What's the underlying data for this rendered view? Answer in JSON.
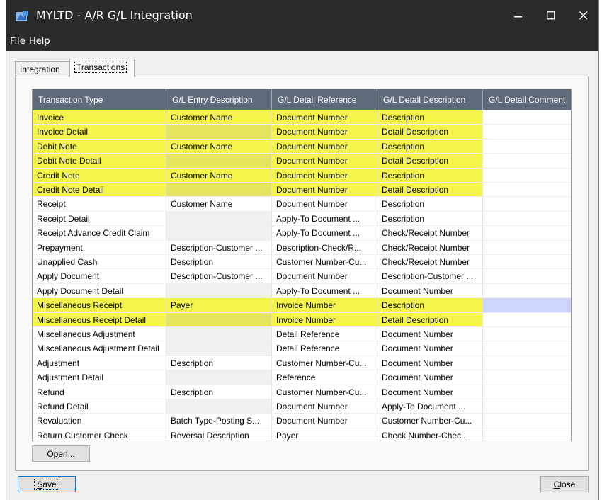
{
  "window": {
    "title": "MYLTD - A/R G/L Integration",
    "controls": {
      "minimize": "minimize",
      "maximize": "maximize",
      "close": "close"
    }
  },
  "menu": [
    {
      "accel": "F",
      "rest": "ile"
    },
    {
      "accel": "H",
      "rest": "elp"
    }
  ],
  "tabs": [
    {
      "label": "Integration",
      "active": false
    },
    {
      "label": "Transactions",
      "active": true
    }
  ],
  "grid": {
    "columns": [
      "Transaction Type",
      "G/L Entry Description",
      "G/L Detail Reference",
      "G/L Detail Description",
      "G/L Detail Comment"
    ],
    "rows": [
      {
        "cells": [
          "Invoice",
          "Customer Name",
          "Document Number",
          "Description",
          ""
        ],
        "highlight": true
      },
      {
        "cells": [
          "Invoice Detail",
          "",
          "Document Number",
          "Detail Description",
          ""
        ],
        "highlight": true
      },
      {
        "cells": [
          "Debit Note",
          "Customer Name",
          "Document Number",
          "Description",
          ""
        ],
        "highlight": true
      },
      {
        "cells": [
          "Debit Note Detail",
          "",
          "Document Number",
          "Detail Description",
          ""
        ],
        "highlight": true
      },
      {
        "cells": [
          "Credit Note",
          "Customer Name",
          "Document Number",
          "Description",
          ""
        ],
        "highlight": true
      },
      {
        "cells": [
          "Credit Note Detail",
          "",
          "Document Number",
          "Detail Description",
          ""
        ],
        "highlight": true
      },
      {
        "cells": [
          "Receipt",
          "Customer Name",
          "Document Number",
          "Description",
          ""
        ],
        "highlight": false
      },
      {
        "cells": [
          "Receipt Detail",
          "",
          "Apply-To Document ...",
          "Description",
          ""
        ],
        "highlight": false
      },
      {
        "cells": [
          "Receipt Advance Credit Claim",
          "",
          "Apply-To Document ...",
          "Check/Receipt Number",
          ""
        ],
        "highlight": false
      },
      {
        "cells": [
          "Prepayment",
          "Description-Customer ...",
          "Description-Check/R...",
          "Check/Receipt Number",
          ""
        ],
        "highlight": false
      },
      {
        "cells": [
          "Unapplied Cash",
          "Description",
          "Customer Number-Cu...",
          "Check/Receipt Number",
          ""
        ],
        "highlight": false
      },
      {
        "cells": [
          "Apply Document",
          "Description-Customer ...",
          "Document Number",
          "Description-Customer ...",
          ""
        ],
        "highlight": false
      },
      {
        "cells": [
          "Apply Document Detail",
          "",
          "Apply-To Document ...",
          "Document Number",
          ""
        ],
        "highlight": false
      },
      {
        "cells": [
          "Miscellaneous Receipt",
          "Payer",
          "Invoice Number",
          "Description",
          ""
        ],
        "highlight": true,
        "selected": true
      },
      {
        "cells": [
          "Miscellaneous Receipt Detail",
          "",
          "Invoice Number",
          "Detail Description",
          ""
        ],
        "highlight": true
      },
      {
        "cells": [
          "Miscellaneous Adjustment",
          "",
          "Detail Reference",
          "Document Number",
          ""
        ],
        "highlight": false
      },
      {
        "cells": [
          "Miscellaneous Adjustment Detail",
          "",
          "Detail Reference",
          "Document Number",
          ""
        ],
        "highlight": false
      },
      {
        "cells": [
          "Adjustment",
          "Description",
          "Customer Number-Cu...",
          "Document Number",
          ""
        ],
        "highlight": false
      },
      {
        "cells": [
          "Adjustment Detail",
          "",
          "Reference",
          "Document Number",
          ""
        ],
        "highlight": false
      },
      {
        "cells": [
          "Refund",
          "Description",
          "Customer Number-Cu...",
          "Document Number",
          ""
        ],
        "highlight": false
      },
      {
        "cells": [
          "Refund Detail",
          "",
          "Document Number",
          "Apply-To Document ...",
          ""
        ],
        "highlight": false
      },
      {
        "cells": [
          "Revaluation",
          "Batch Type-Posting S...",
          "Document Number",
          "Customer Number-Cu...",
          ""
        ],
        "highlight": false
      },
      {
        "cells": [
          "Return Customer Check",
          "Reversal Description",
          "Payer",
          "Check Number-Chec...",
          ""
        ],
        "highlight": false
      }
    ]
  },
  "buttons": {
    "open": {
      "accel": "O",
      "rest": "pen..."
    },
    "save": {
      "accel": "S",
      "rest": "ave"
    },
    "close": {
      "accel": "C",
      "rest": "lose"
    }
  },
  "colors": {
    "titlebar": "#2b2b2b",
    "header": "#5f6b78",
    "highlight": "#f4f44a",
    "selection": "#cdd5ff"
  }
}
